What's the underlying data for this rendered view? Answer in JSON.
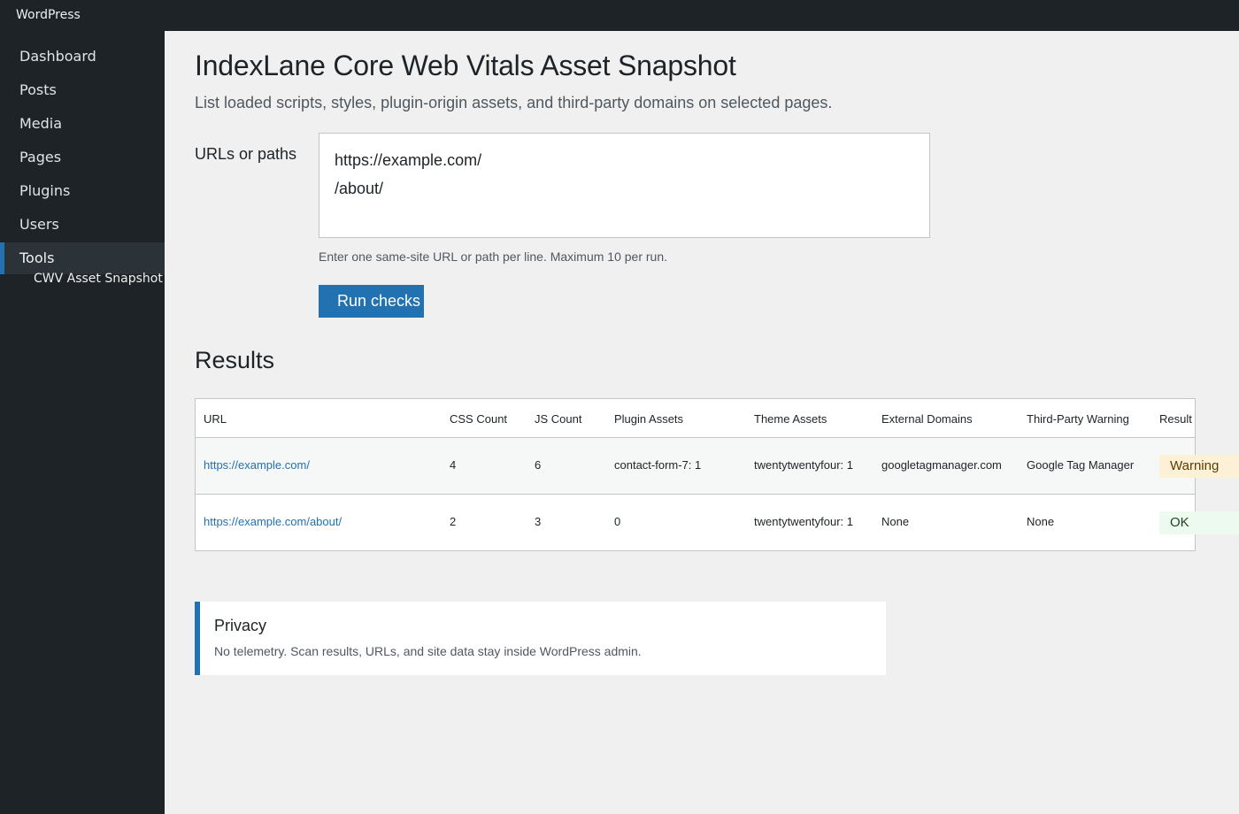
{
  "admin_bar": {
    "brand": "WordPress"
  },
  "sidebar": {
    "items": [
      {
        "label": "Dashboard"
      },
      {
        "label": "Posts"
      },
      {
        "label": "Media"
      },
      {
        "label": "Pages"
      },
      {
        "label": "Plugins"
      },
      {
        "label": "Users"
      },
      {
        "label": "Tools",
        "active": true
      }
    ],
    "submenu": {
      "label": "CWV Asset Snapshot"
    }
  },
  "page": {
    "title": "IndexLane Core Web Vitals Asset Snapshot",
    "description": "List loaded scripts, styles, plugin-origin assets, and third-party domains on selected pages."
  },
  "form": {
    "urls_label": "URLs or paths",
    "urls_value": "https://example.com/\n/about/",
    "help": "Enter one same-site URL or path per line. Maximum 10 per run.",
    "submit_label": "Run checks"
  },
  "results": {
    "title": "Results",
    "columns": [
      "URL",
      "CSS Count",
      "JS Count",
      "Plugin Assets",
      "Theme Assets",
      "External Domains",
      "Third-Party Warning",
      "Result"
    ],
    "rows": [
      {
        "url": "https://example.com/",
        "css_count": "4",
        "js_count": "6",
        "plugin_assets": "contact-form-7: 1",
        "theme_assets": "twentytwentyfour: 1",
        "external_domains": "googletagmanager.com",
        "third_party_warning": "Google Tag Manager",
        "result": "Warning"
      },
      {
        "url": "https://example.com/about/",
        "css_count": "2",
        "js_count": "3",
        "plugin_assets": "0",
        "theme_assets": "twentytwentyfour: 1",
        "external_domains": "None",
        "third_party_warning": "None",
        "result": "OK"
      }
    ]
  },
  "privacy": {
    "title": "Privacy",
    "text": "No telemetry. Scan results, URLs, and site data stay inside WordPress admin."
  },
  "colors": {
    "admin_dark": "#1d2327",
    "accent": "#2271b1",
    "warning_bg": "#fcf0d6",
    "ok_bg": "#edfaef"
  }
}
